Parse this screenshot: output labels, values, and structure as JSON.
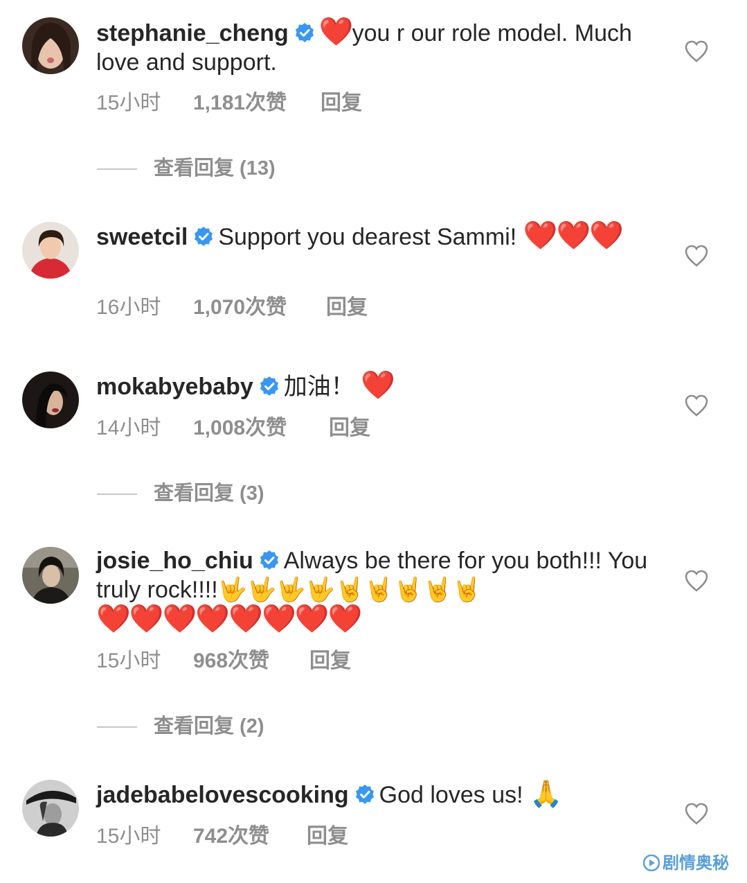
{
  "comments": [
    {
      "username": "stephanie_cheng",
      "text": "you r our role model. Much love and support.",
      "lead_emoji": "❤️",
      "time": "15小时",
      "likes": "1,181次赞",
      "reply": "回复",
      "view_replies": "查看回复 (13)"
    },
    {
      "username": "sweetcil",
      "text": "Support you dearest Sammi!",
      "trail_emoji": "❤️❤️❤️",
      "time": "16小时",
      "likes": "1,070次赞",
      "reply": "回复"
    },
    {
      "username": "mokabyebaby",
      "text": "加油！",
      "trail_emoji": "❤️",
      "time": "14小时",
      "likes": "1,008次赞",
      "reply": "回复",
      "view_replies": "查看回复 (3)"
    },
    {
      "username": "josie_ho_chiu",
      "text": "Always be there for you both!!! You truly rock!!!!",
      "hands_emoji": "🤟🤟🤟🤟🤘🤘🤘🤘🤘",
      "trail_emoji": "❤️❤️❤️❤️❤️❤️❤️❤️",
      "time": "15小时",
      "likes": "968次赞",
      "reply": "回复",
      "view_replies": "查看回复 (2)"
    },
    {
      "username": "jadebabelovescooking",
      "text": "God loves us!",
      "trail_emoji": "🙏",
      "time": "15小时",
      "likes": "742次赞",
      "reply": "回复"
    }
  ],
  "watermark": "剧情奥秘",
  "colors": {
    "verified": "#3897f0",
    "heart": "#e0162b",
    "meta": "#8e8e8e"
  },
  "icons": {
    "verified": "verified-badge-icon",
    "like": "heart-outline-icon"
  }
}
